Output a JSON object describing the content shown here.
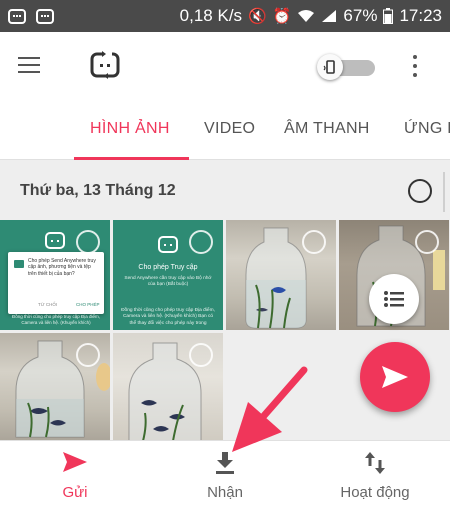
{
  "status_bar": {
    "speed": "0,18 K/s",
    "battery": "67%",
    "time": "17:23"
  },
  "tabs": [
    {
      "label": "HÌNH ẢNH",
      "active": true
    },
    {
      "label": "VIDEO",
      "active": false
    },
    {
      "label": "ÂM THANH",
      "active": false
    },
    {
      "label": "ỨNG D",
      "active": false
    }
  ],
  "content": {
    "date_header": "Thứ ba, 13 Tháng 12"
  },
  "thumbnails": {
    "dialog_text": "Cho phép Send Anywhere truy cập ảnh, phương tiện và tệp trên thiết bị của bạn?",
    "dialog_deny": "TỪ CHỐI",
    "dialog_allow": "CHO PHÉP",
    "caption_1": "Đồng thời cũng cho phép truy cập Địa điểm, Camera và liên hệ. (Khuyến khích)",
    "caption_2": "Bạn có thể thay đổi việc cho phép này trong",
    "perm_title": "Cho phép Truy cập",
    "perm_body": "Send Anywhere cần truy cập vào Bộ nhớ của bạn (Bắt buộc)",
    "perm_body2": "Đồng thời cũng cho phép truy cập Địa điểm, Camera và liên hệ. (Khuyến khích) Bạn có thể thay đổi việc cho phép này trong"
  },
  "bottom_nav": {
    "send": "Gửi",
    "receive": "Nhận",
    "activity": "Hoạt động"
  },
  "colors": {
    "accent": "#f0365a",
    "status_bar": "#4a4a4a",
    "teal": "#2e8b74"
  },
  "icons": [
    "notification-icon",
    "mute-icon",
    "alarm-icon",
    "wifi-icon",
    "signal-icon",
    "battery-icon",
    "menu-icon",
    "app-logo-icon",
    "device-toggle-icon",
    "more-vert-icon",
    "list-icon",
    "send-icon",
    "download-icon",
    "swap-vert-icon"
  ]
}
